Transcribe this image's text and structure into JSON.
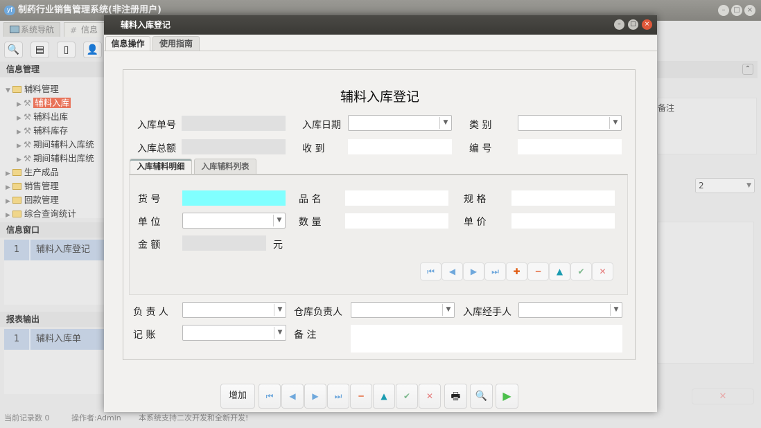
{
  "app": {
    "title": "制药行业销售管理系统(非注册用户)",
    "logo": "yf"
  },
  "bg_tabs": [
    "系统导航",
    "信息"
  ],
  "left": {
    "info_mgmt_title": "信息管理",
    "tree": [
      {
        "label": "辅料管理",
        "type": "folder",
        "expanded": true
      },
      {
        "label": "辅料入库",
        "type": "leaf",
        "selected": true
      },
      {
        "label": "辅料出库",
        "type": "leaf"
      },
      {
        "label": "辅料库存",
        "type": "leaf"
      },
      {
        "label": "期间辅料入库统",
        "type": "leaf"
      },
      {
        "label": "期间辅料出库统",
        "type": "leaf"
      },
      {
        "label": "生产成品",
        "type": "folder"
      },
      {
        "label": "销售管理",
        "type": "folder"
      },
      {
        "label": "回款管理",
        "type": "folder"
      },
      {
        "label": "综合查询统计",
        "type": "folder"
      }
    ],
    "info_window_title": "信息窗口",
    "info_window_rows": [
      {
        "no": "1",
        "name": "辅料入库登记"
      }
    ],
    "report_title": "报表输出",
    "report_rows": [
      {
        "no": "1",
        "name": "辅料入库单"
      }
    ]
  },
  "right": {
    "col_header": "备注",
    "page_select": "2"
  },
  "status": {
    "records": "当前记录数 0",
    "operator": "操作者:Admin",
    "notice": "本系统支持二次开发和全新开发!"
  },
  "dialog": {
    "title": "辅料入库登记",
    "tabs": [
      "信息操作",
      "使用指南"
    ],
    "form_title": "辅料入库登记",
    "labels": {
      "order_no": "入库单号",
      "date": "入库日期",
      "category": "类 别",
      "total": "入库总额",
      "received": "收 到",
      "number": "编 号",
      "item_no": "货 号",
      "item_name": "品 名",
      "spec": "规 格",
      "unit": "单 位",
      "qty": "数 量",
      "price": "单 价",
      "amount": "金 额",
      "yuan": "元",
      "responsible": "负 责 人",
      "warehouse_resp": "仓库负责人",
      "handler": "入库经手人",
      "bookkeeping": "记 账",
      "remark": "备 注"
    },
    "inner_tabs": [
      "入库辅料明细",
      "入库辅料列表"
    ],
    "add_label": "增加"
  },
  "colors": {
    "accent_selected": "#e8735a",
    "cyan_field": "#80ffff",
    "list_selected": "#c3cfe0"
  }
}
